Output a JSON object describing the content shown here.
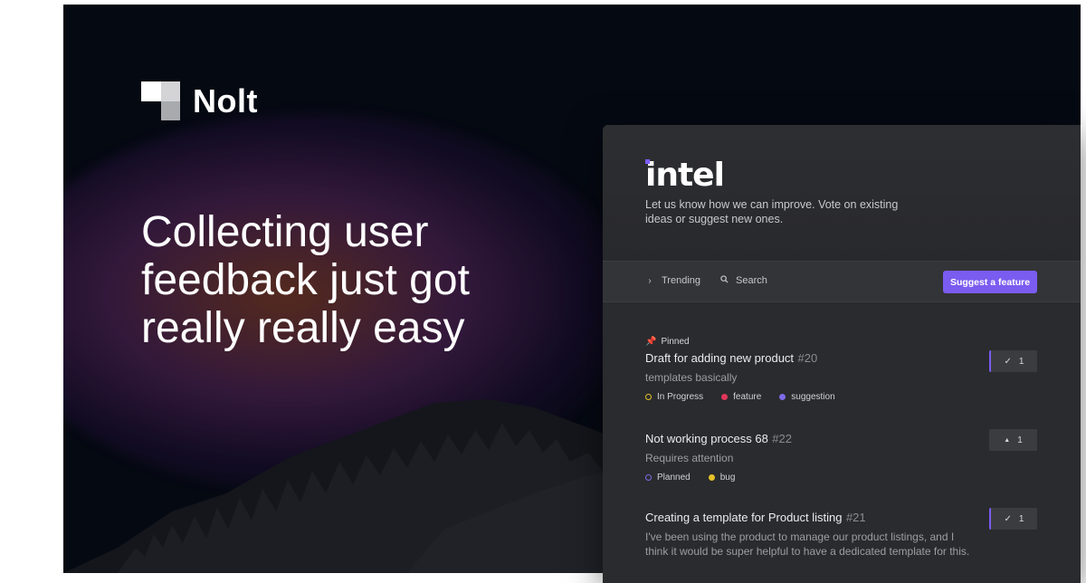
{
  "brand": {
    "logo_text": "Nolt"
  },
  "hero": {
    "headline_lines": [
      "Collecting user",
      "feedback just got",
      "really really easy"
    ]
  },
  "card": {
    "company": "intel",
    "tagline": "Let us know how we can improve. Vote on existing ideas or suggest new ones.",
    "toolbar": {
      "trending_label": "Trending",
      "search_label": "Search",
      "suggest_label": "Suggest a feature"
    },
    "posts": [
      {
        "pinned_label": "Pinned",
        "title": "Draft for adding new product",
        "number": "#20",
        "description": "templates basically",
        "tags": [
          {
            "label": "In Progress",
            "color": "#e6c229",
            "kind": "ring"
          },
          {
            "label": "feature",
            "color": "#e0365a",
            "kind": "dot"
          },
          {
            "label": "suggestion",
            "color": "#7b6be6",
            "kind": "dot"
          }
        ],
        "vote_icon": "✓",
        "vote_count": "1",
        "voted": true
      },
      {
        "title": "Not working process 68",
        "number": "#22",
        "description": "Requires attention",
        "tags": [
          {
            "label": "Planned",
            "color": "#7b6be6",
            "kind": "ring"
          },
          {
            "label": "bug",
            "color": "#e6c229",
            "kind": "dot"
          }
        ],
        "vote_icon": "▲",
        "vote_count": "1",
        "voted": false
      },
      {
        "title": "Creating a template for Product listing",
        "number": "#21",
        "description": "I've been using the product to manage our product listings, and I think it would be super helpful to have a dedicated template for this.",
        "vote_icon": "✓",
        "vote_count": "1",
        "voted": true
      }
    ]
  },
  "colors": {
    "accent": "#7b5cf0",
    "background": "#050912",
    "card": "#2a2b2e"
  }
}
